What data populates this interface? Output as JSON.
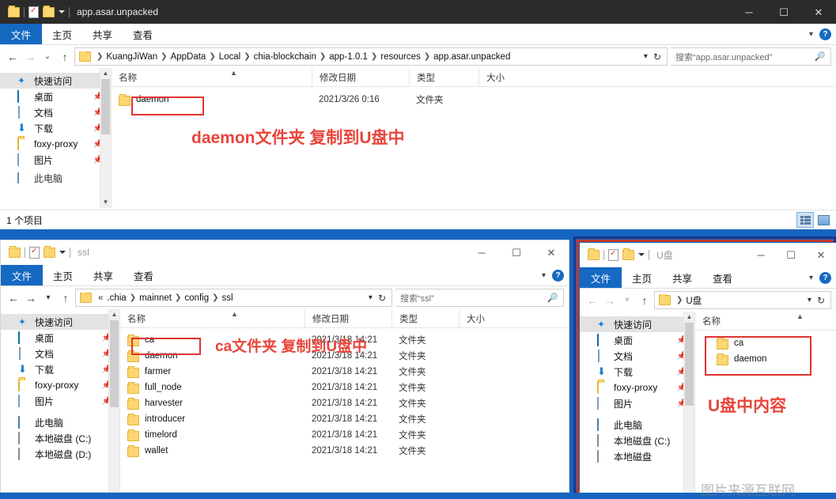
{
  "desktop": {
    "background_color": "#1565c0"
  },
  "windows": {
    "top": {
      "title": "app.asar.unpacked",
      "titlebar_style": "dark",
      "quick_access": {
        "folder_icon": "folder-icon",
        "properties_icon": "properties-icon",
        "new_folder_icon": "new-folder-icon",
        "dropdown_icon": "chevron-down-icon"
      },
      "window_buttons": {
        "minimize": "─",
        "maximize": "☐",
        "close": "✕"
      },
      "ribbon_tabs": [
        {
          "label": "文件",
          "active": true
        },
        {
          "label": "主页",
          "active": false
        },
        {
          "label": "共享",
          "active": false
        },
        {
          "label": "查看",
          "active": false
        }
      ],
      "ribbon_right": {
        "collapse_icon": "chevron-down-icon",
        "help_icon": "help-icon",
        "help_label": "?"
      },
      "nav": {
        "back": "←",
        "forward": "→",
        "recent": "⌄",
        "up": "↑"
      },
      "breadcrumb": [
        "KuangJiWan",
        "AppData",
        "Local",
        "chia-blockchain",
        "app-1.0.1",
        "resources",
        "app.asar.unpacked"
      ],
      "address_tools": {
        "history_icon": "chevron-down-icon",
        "refresh_icon": "refresh-icon",
        "refresh_glyph": "↻"
      },
      "search": {
        "placeholder": "搜索“app.asar.unpacked”",
        "icon": "search-icon"
      },
      "nav_pane": [
        {
          "label": "快速访问",
          "icon": "star-icon",
          "selected": true,
          "pinned": false
        },
        {
          "label": "桌面",
          "icon": "desktop-icon",
          "selected": false,
          "pinned": true
        },
        {
          "label": "文档",
          "icon": "documents-icon",
          "selected": false,
          "pinned": true
        },
        {
          "label": "下载",
          "icon": "downloads-icon",
          "selected": false,
          "pinned": true
        },
        {
          "label": "foxy-proxy",
          "icon": "folder-icon",
          "selected": false,
          "pinned": true
        },
        {
          "label": "图片",
          "icon": "pictures-icon",
          "selected": false,
          "pinned": true
        },
        {
          "label": "此电脑",
          "icon": "this-pc-icon",
          "selected": false,
          "pinned": false
        }
      ],
      "columns": [
        "名称",
        "修改日期",
        "类型",
        "大小"
      ],
      "rows": [
        {
          "name": "daemon",
          "modified": "2021/3/26 0:16",
          "type": "文件夹",
          "size": ""
        }
      ],
      "status": "1 个项目",
      "view_buttons": {
        "details": "details-view-icon",
        "large_icons": "large-icons-view-icon"
      },
      "annotation": "daemon文件夹 复制到U盘中"
    },
    "bottom_left": {
      "title": "ssl",
      "titlebar_style": "light",
      "window_buttons": {
        "minimize": "─",
        "maximize": "☐",
        "close": "✕"
      },
      "ribbon_tabs": [
        {
          "label": "文件",
          "active": true
        },
        {
          "label": "主页",
          "active": false
        },
        {
          "label": "共享",
          "active": false
        },
        {
          "label": "查看",
          "active": false
        }
      ],
      "breadcrumb": [
        "«",
        ".chia",
        "mainnet",
        "config",
        "ssl"
      ],
      "search": {
        "placeholder": "搜索“ssl”",
        "icon": "search-icon"
      },
      "nav_pane": [
        {
          "label": "快速访问",
          "icon": "star-icon",
          "selected": true,
          "pinned": false
        },
        {
          "label": "桌面",
          "icon": "desktop-icon",
          "selected": false,
          "pinned": true
        },
        {
          "label": "文档",
          "icon": "documents-icon",
          "selected": false,
          "pinned": true
        },
        {
          "label": "下载",
          "icon": "downloads-icon",
          "selected": false,
          "pinned": true
        },
        {
          "label": "foxy-proxy",
          "icon": "folder-icon",
          "selected": false,
          "pinned": true
        },
        {
          "label": "图片",
          "icon": "pictures-icon",
          "selected": false,
          "pinned": true
        },
        {
          "label": "此电脑",
          "icon": "this-pc-icon",
          "selected": false,
          "pinned": false
        },
        {
          "label": "本地磁盘 (C:)",
          "icon": "disk-icon",
          "selected": false,
          "pinned": false
        },
        {
          "label": "本地磁盘 (D:)",
          "icon": "disk-icon",
          "selected": false,
          "pinned": false
        }
      ],
      "columns": [
        "名称",
        "修改日期",
        "类型",
        "大小"
      ],
      "rows": [
        {
          "name": "ca",
          "modified": "2021/3/18 14:21",
          "type": "文件夹",
          "size": ""
        },
        {
          "name": "daemon",
          "modified": "2021/3/18 14:21",
          "type": "文件夹",
          "size": ""
        },
        {
          "name": "farmer",
          "modified": "2021/3/18 14:21",
          "type": "文件夹",
          "size": ""
        },
        {
          "name": "full_node",
          "modified": "2021/3/18 14:21",
          "type": "文件夹",
          "size": ""
        },
        {
          "name": "harvester",
          "modified": "2021/3/18 14:21",
          "type": "文件夹",
          "size": ""
        },
        {
          "name": "introducer",
          "modified": "2021/3/18 14:21",
          "type": "文件夹",
          "size": ""
        },
        {
          "name": "timelord",
          "modified": "2021/3/18 14:21",
          "type": "文件夹",
          "size": ""
        },
        {
          "name": "wallet",
          "modified": "2021/3/18 14:21",
          "type": "文件夹",
          "size": ""
        }
      ],
      "annotation": "ca文件夹 复制到U盘中"
    },
    "bottom_right": {
      "title": "U盘",
      "titlebar_style": "light",
      "window_buttons": {
        "minimize": "─",
        "maximize": "☐",
        "close": "✕"
      },
      "ribbon_tabs": [
        {
          "label": "文件",
          "active": true
        },
        {
          "label": "主页",
          "active": false
        },
        {
          "label": "共享",
          "active": false
        },
        {
          "label": "查看",
          "active": false
        }
      ],
      "breadcrumb": [
        "U盘"
      ],
      "nav_pane": [
        {
          "label": "快速访问",
          "icon": "star-icon",
          "selected": true,
          "pinned": false
        },
        {
          "label": "桌面",
          "icon": "desktop-icon",
          "selected": false,
          "pinned": true
        },
        {
          "label": "文档",
          "icon": "documents-icon",
          "selected": false,
          "pinned": true
        },
        {
          "label": "下载",
          "icon": "downloads-icon",
          "selected": false,
          "pinned": true
        },
        {
          "label": "foxy-proxy",
          "icon": "folder-icon",
          "selected": false,
          "pinned": true
        },
        {
          "label": "图片",
          "icon": "pictures-icon",
          "selected": false,
          "pinned": true
        },
        {
          "label": "此电脑",
          "icon": "this-pc-icon",
          "selected": false,
          "pinned": false
        },
        {
          "label": "本地磁盘 (C:)",
          "icon": "disk-icon",
          "selected": false,
          "pinned": false
        },
        {
          "label": "本地磁盘",
          "icon": "disk-icon",
          "selected": false,
          "pinned": false
        }
      ],
      "columns": [
        "名称"
      ],
      "rows": [
        {
          "name": "ca"
        },
        {
          "name": "daemon"
        }
      ],
      "annotation": "U盘中内容"
    }
  },
  "colors": {
    "accent_blue": "#1565c0",
    "annotation_red": "#e8453c",
    "redbox_red": "#e03131",
    "ribbon_file_blue": "#1669c1",
    "folder_yellow": "#fcd670"
  }
}
